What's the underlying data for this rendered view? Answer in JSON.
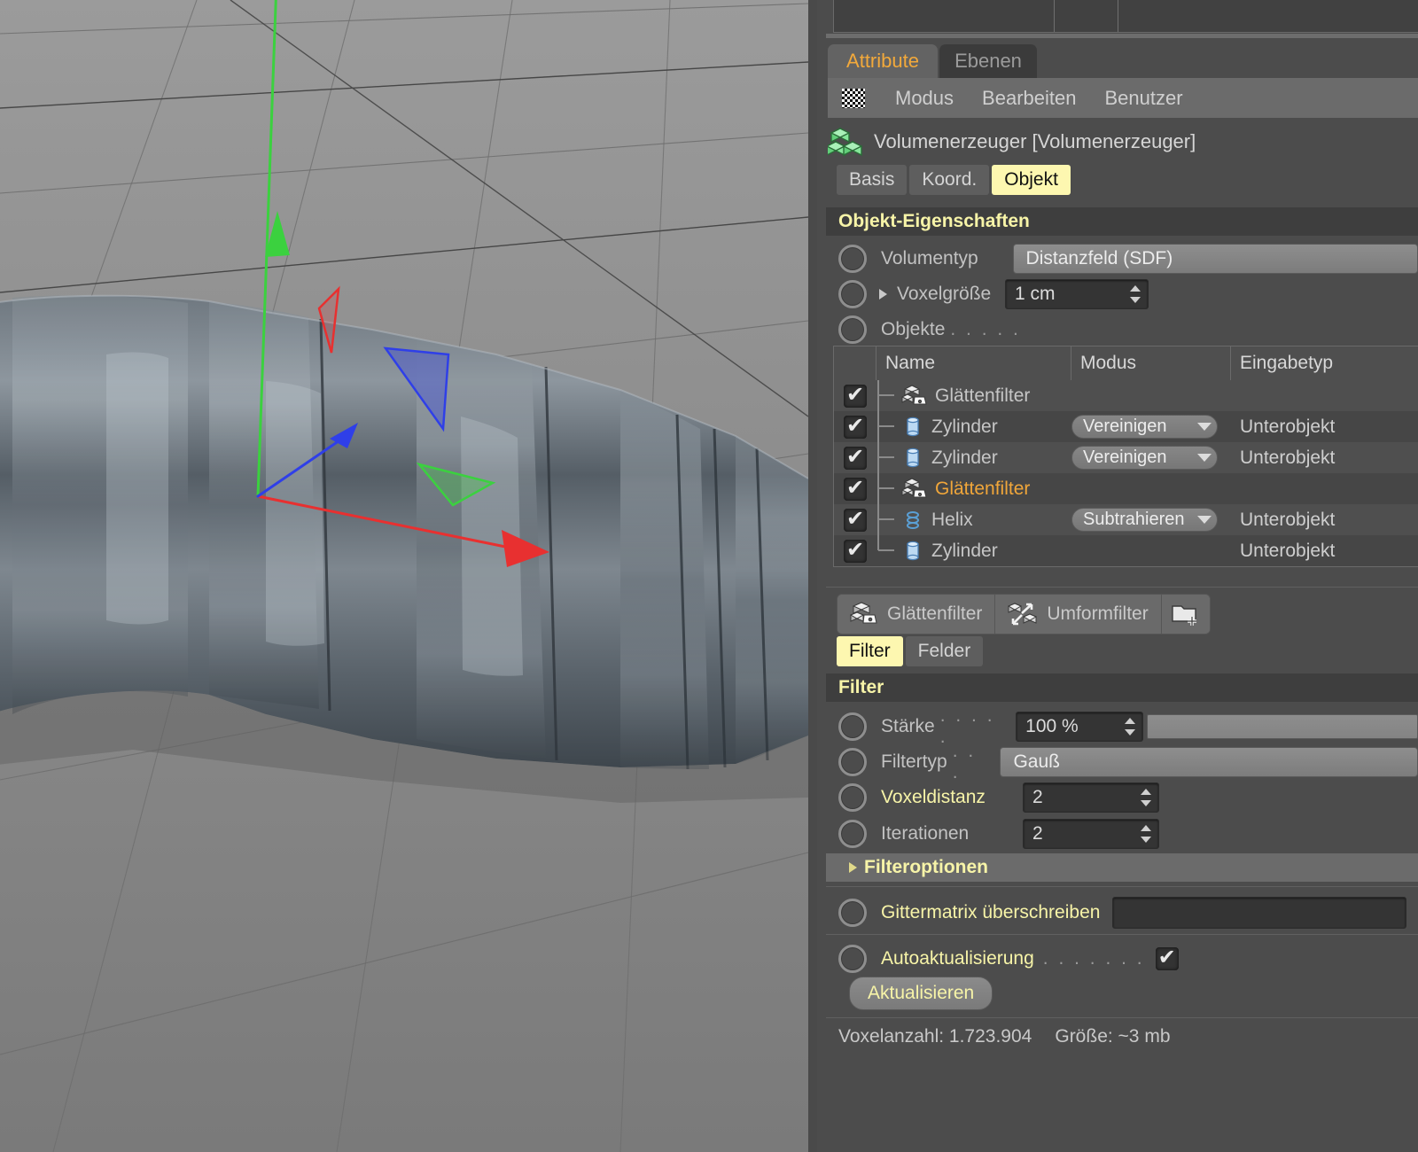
{
  "app": {
    "panel_tabs": [
      {
        "label": "Attribute",
        "active": true
      },
      {
        "label": "Ebenen",
        "active": false
      }
    ],
    "menu": {
      "icon": "grid-checker-icon",
      "items": [
        "Modus",
        "Bearbeiten",
        "Benutzer"
      ]
    },
    "object_header": {
      "icon": "volume-generator-icon",
      "title": "Volumenerzeuger [Volumenerzeuger]"
    },
    "sub_tabs": [
      {
        "label": "Basis",
        "active": false
      },
      {
        "label": "Koord.",
        "active": false
      },
      {
        "label": "Objekt",
        "active": true
      }
    ]
  },
  "object_properties": {
    "section_title": "Objekt-Eigenschaften",
    "volumentyp": {
      "label": "Volumentyp",
      "value": "Distanzfeld (SDF)"
    },
    "voxelgroesse": {
      "label": "Voxelgröße",
      "value": "1 cm",
      "expander": "triangle-right-icon"
    },
    "objekte": {
      "label": "Objekte",
      "dots": ". . . . ."
    }
  },
  "object_list": {
    "columns": [
      "",
      "Name",
      "Modus",
      "Eingabetyp"
    ],
    "rows": [
      {
        "checked": true,
        "icon": "smooth-filter-icon",
        "name": "Glättenfilter",
        "highlight": false,
        "mode": "",
        "type": ""
      },
      {
        "checked": true,
        "icon": "cylinder-icon",
        "name": "Zylinder",
        "highlight": false,
        "mode": "Vereinigen",
        "type": "Unterobjekt"
      },
      {
        "checked": true,
        "icon": "cylinder-icon",
        "name": "Zylinder",
        "highlight": false,
        "mode": "Vereinigen",
        "type": "Unterobjekt"
      },
      {
        "checked": true,
        "icon": "smooth-filter-icon",
        "name": "Glättenfilter",
        "highlight": true,
        "mode": "",
        "type": ""
      },
      {
        "checked": true,
        "icon": "helix-icon",
        "name": "Helix",
        "highlight": false,
        "mode": "Subtrahieren",
        "type": "Unterobjekt"
      },
      {
        "checked": true,
        "icon": "cylinder-icon",
        "name": "Zylinder",
        "highlight": false,
        "mode": "",
        "type": "Unterobjekt"
      }
    ]
  },
  "filter_buttons": [
    {
      "label": "Glättenfilter",
      "icon": "smooth-filter-icon"
    },
    {
      "label": "Umformfilter",
      "icon": "reshape-filter-icon"
    },
    {
      "label": "",
      "icon": "new-folder-icon"
    }
  ],
  "filter_tabs": [
    {
      "label": "Filter",
      "active": true
    },
    {
      "label": "Felder",
      "active": false
    }
  ],
  "filter": {
    "section_title": "Filter",
    "staerke": {
      "label": "Stärke",
      "dots": ". . . . .",
      "value": "100 %",
      "slider_percent": 100
    },
    "filtertyp": {
      "label": "Filtertyp",
      "dots": ". . .",
      "value": "Gauß"
    },
    "voxeldistanz": {
      "label": "Voxeldistanz",
      "value": "2"
    },
    "iterationen": {
      "label": "Iterationen",
      "value": "2"
    },
    "filteroptionen": {
      "label": "Filteroptionen",
      "expander": "triangle-right-icon"
    }
  },
  "grid": {
    "gittermatrix": {
      "label": "Gittermatrix überschreiben",
      "value": ""
    },
    "autoupdate": {
      "label": "Autoaktualisierung",
      "dots": ". . . . . . .",
      "checked": true
    },
    "update_button": "Aktualisieren"
  },
  "status": {
    "voxel_count": "Voxelanzahl: 1.723.904",
    "size": "Größe: ~3 mb"
  },
  "colors": {
    "accent_yellow": "#f7f4a8",
    "accent_orange": "#f0a63a",
    "tab_active_bg": "#fdf7b0",
    "panel_bg": "#4c4c4c",
    "axis_x": "#e02b2b",
    "axis_y": "#36d13a",
    "axis_z": "#2c3ce0"
  },
  "viewport": {
    "label": "3d-viewport-corrugated-tube",
    "gizmo": [
      "x-axis-handle",
      "y-axis-handle",
      "z-axis-handle",
      "x-rotation-band",
      "y-rotation-band",
      "z-rotation-band"
    ]
  }
}
